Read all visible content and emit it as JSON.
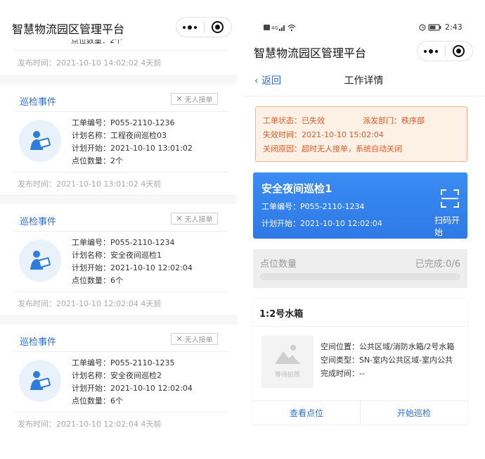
{
  "app": {
    "title": "智慧物流园区管理平台"
  },
  "status_bar": {
    "time": "2:43"
  },
  "left": {
    "top_cut_text": "点位数量：2个",
    "top_publish": "发布时间：2021-10-10 14:02:02 4天前",
    "cards": [
      {
        "title": "巡检事件",
        "tag": "无人接单",
        "order_no": "工单编号：P055-2110-1236",
        "plan_name": "计划名称：工程夜间巡检03",
        "plan_start": "计划开始：2021-10-10 13:01:02",
        "point_count": "点位数量：2个",
        "publish": "发布时间：2021-10-10 13:01:02 4天前"
      },
      {
        "title": "巡检事件",
        "tag": "无人接单",
        "order_no": "工单编号：P055-2110-1234",
        "plan_name": "计划名称：安全夜间巡检1",
        "plan_start": "计划开始：2021-10-10 12:02:04",
        "point_count": "点位数量：6个",
        "publish": "发布时间：2021-10-10 12:02:04 4天前"
      },
      {
        "title": "巡检事件",
        "tag": "无人接单",
        "order_no": "工单编号：P055-2110-1235",
        "plan_name": "计划名称：安全夜间巡检2",
        "plan_start": "计划开始：2021-10-10 12:02:04",
        "point_count": "点位数量：6个",
        "publish": "发布时间：2021-10-10 12:02:04 4天前"
      }
    ]
  },
  "right": {
    "back_label": "返回",
    "nav_title": "工作详情",
    "alert": {
      "status": "工单状态：已失效",
      "dept": "派发部门：秩序部",
      "expire": "失效时间：2021-10-10 15:02:04",
      "reason": "关闭原因：超时无人接单，系统自动关闭"
    },
    "task": {
      "title": "安全夜间巡检1",
      "order_no": "工单编号：P055-2110-1234",
      "plan_start": "计划开始：2021-10-10 12:02:04",
      "scan_label": "扫码开始"
    },
    "points": {
      "label": "点位数量",
      "completed": "已完成:0/6",
      "progress": 0
    },
    "point_card": {
      "title": "1:2号水箱",
      "photo_placeholder": "等待拍照",
      "location": "空间位置：公共区域/消防水箱/2号水箱",
      "type": "空间类型：SN-室内公共区域-室内公共",
      "done_time": "完成时间：--",
      "view_button": "查看点位",
      "start_button": "开始巡检"
    }
  },
  "colors": {
    "accent": "#2b6fd6",
    "warning_text": "#e05c2a",
    "card_blue": "#3b8cf3"
  }
}
